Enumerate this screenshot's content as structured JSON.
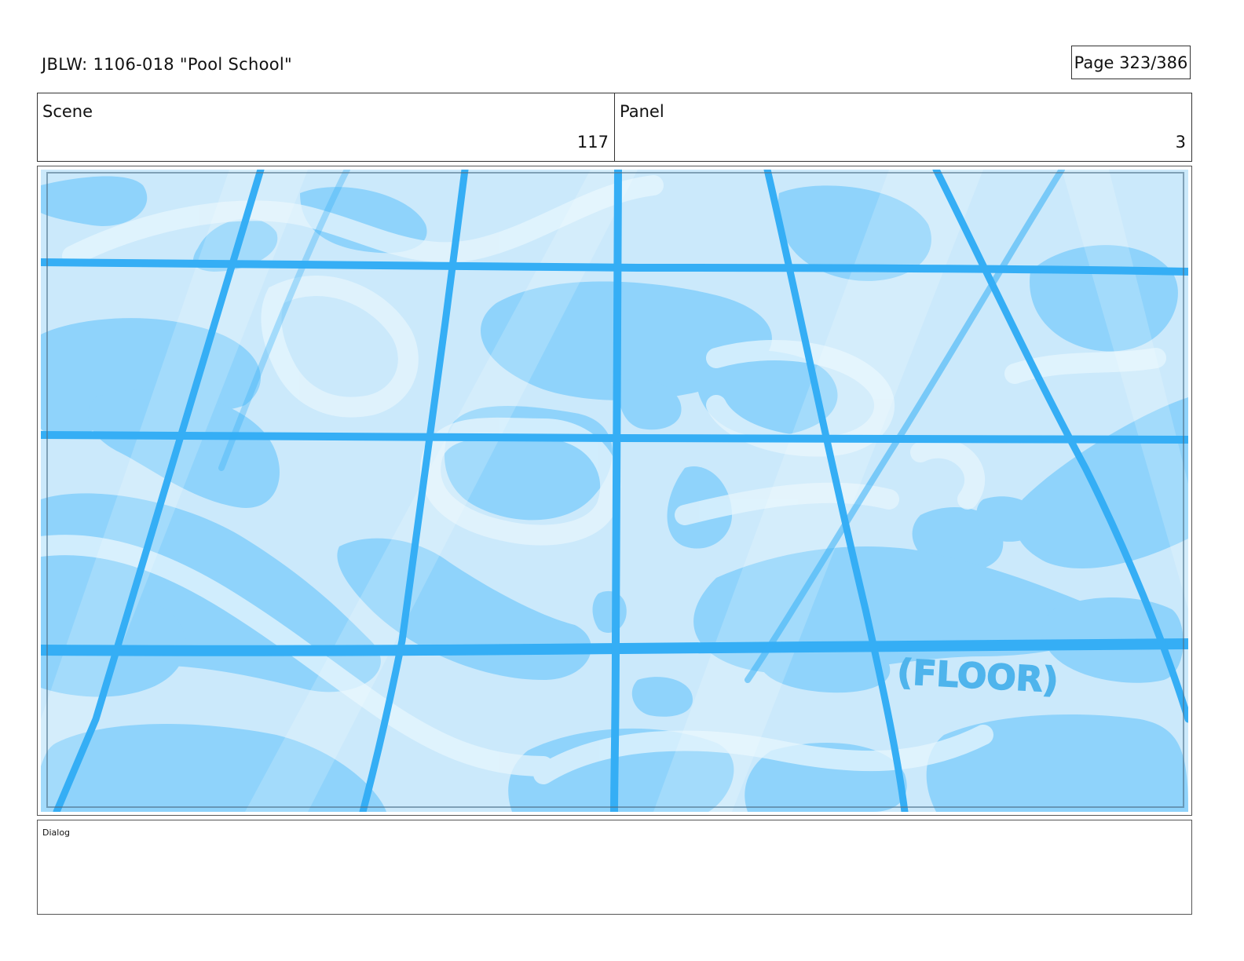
{
  "header": {
    "title": "JBLW: 1106-018 \"Pool School\"",
    "page": "Page 323/386"
  },
  "info": {
    "scene_label": "Scene",
    "scene_value": "117",
    "panel_label": "Panel",
    "panel_value": "3"
  },
  "artwork": {
    "caption": "(FLOOR)",
    "colors": {
      "water_light": "#cbe9fb",
      "water_mid": "#8fd3fb",
      "grout": "#35aef5",
      "highlight": "#e6f5fd"
    }
  },
  "dialog": {
    "label": "Dialog"
  }
}
